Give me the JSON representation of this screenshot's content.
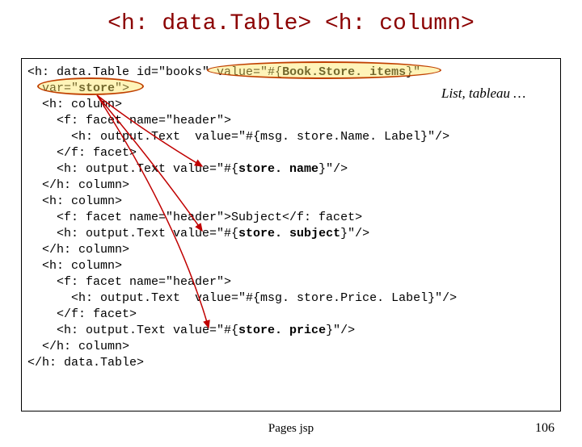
{
  "title": "<h: data.Table> <h: column>",
  "annotation": "List, tableau …",
  "code_lines": [
    "<h: data.Table id=\"books\" value=\"#{Book.Store. items}\"",
    "  var=\"store\">",
    "  <h: column>",
    "    <f: facet name=\"header\">",
    "      <h: output.Text  value=\"#{msg. store.Name. Label}\"/>",
    "    </f: facet>",
    "    <h: output.Text value=\"#{store. name}\"/>",
    "  </h: column>",
    "  <h: column>",
    "    <f: facet name=\"header\">Subject</f: facet>",
    "    <h: output.Text value=\"#{store. subject}\"/>",
    "  </h: column>",
    "  <h: column>",
    "    <f: facet name=\"header\">",
    "      <h: output.Text  value=\"#{msg. store.Price. Label}\"/>",
    "    </f: facet>",
    "    <h: output.Text value=\"#{store. price}\"/>",
    "  </h: column>",
    "</h: data.Table>"
  ],
  "bold_map": {
    "0": [
      [
        "Book.Store. items",
        true
      ]
    ],
    "1": [
      [
        "store",
        true
      ]
    ],
    "6": [
      [
        "store. name",
        true
      ]
    ],
    "10": [
      [
        "store. subject",
        true
      ]
    ],
    "16": [
      [
        "store. price",
        true
      ]
    ]
  },
  "footer_center": "Pages jsp",
  "footer_right": "106"
}
